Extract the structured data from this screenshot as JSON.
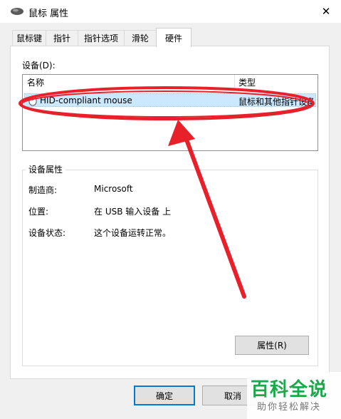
{
  "window": {
    "title": "鼠标 属性",
    "close_glyph": "✕"
  },
  "tabs": [
    {
      "label": "鼠标键"
    },
    {
      "label": "指针"
    },
    {
      "label": "指针选项"
    },
    {
      "label": "滑轮"
    },
    {
      "label": "硬件",
      "active": true
    }
  ],
  "devices": {
    "label": "设备(D):",
    "columns": [
      "名称",
      "类型"
    ],
    "rows": [
      {
        "name": "HID-compliant mouse",
        "type": "鼠标和其他指针设备",
        "selected": true
      }
    ]
  },
  "properties": {
    "group_title": "设备属性",
    "items": [
      {
        "label": "制造商:",
        "value": "Microsoft"
      },
      {
        "label": "位置:",
        "value": "在 USB 输入设备 上"
      },
      {
        "label": "设备状态:",
        "value": "这个设备运转正常。"
      }
    ],
    "button_label": "属性(R)"
  },
  "buttons": {
    "ok": "确定",
    "cancel": "取消"
  },
  "watermark": {
    "title": "百科全说",
    "subtitle": "助你轻松解决"
  },
  "colors": {
    "annotation": "#e8202a",
    "selection": "#cce8ff",
    "accent": "#0078d7",
    "watermark": "#1aa84a"
  },
  "icons": [
    "mouse-icon",
    "close-icon",
    "device-mouse-icon"
  ]
}
